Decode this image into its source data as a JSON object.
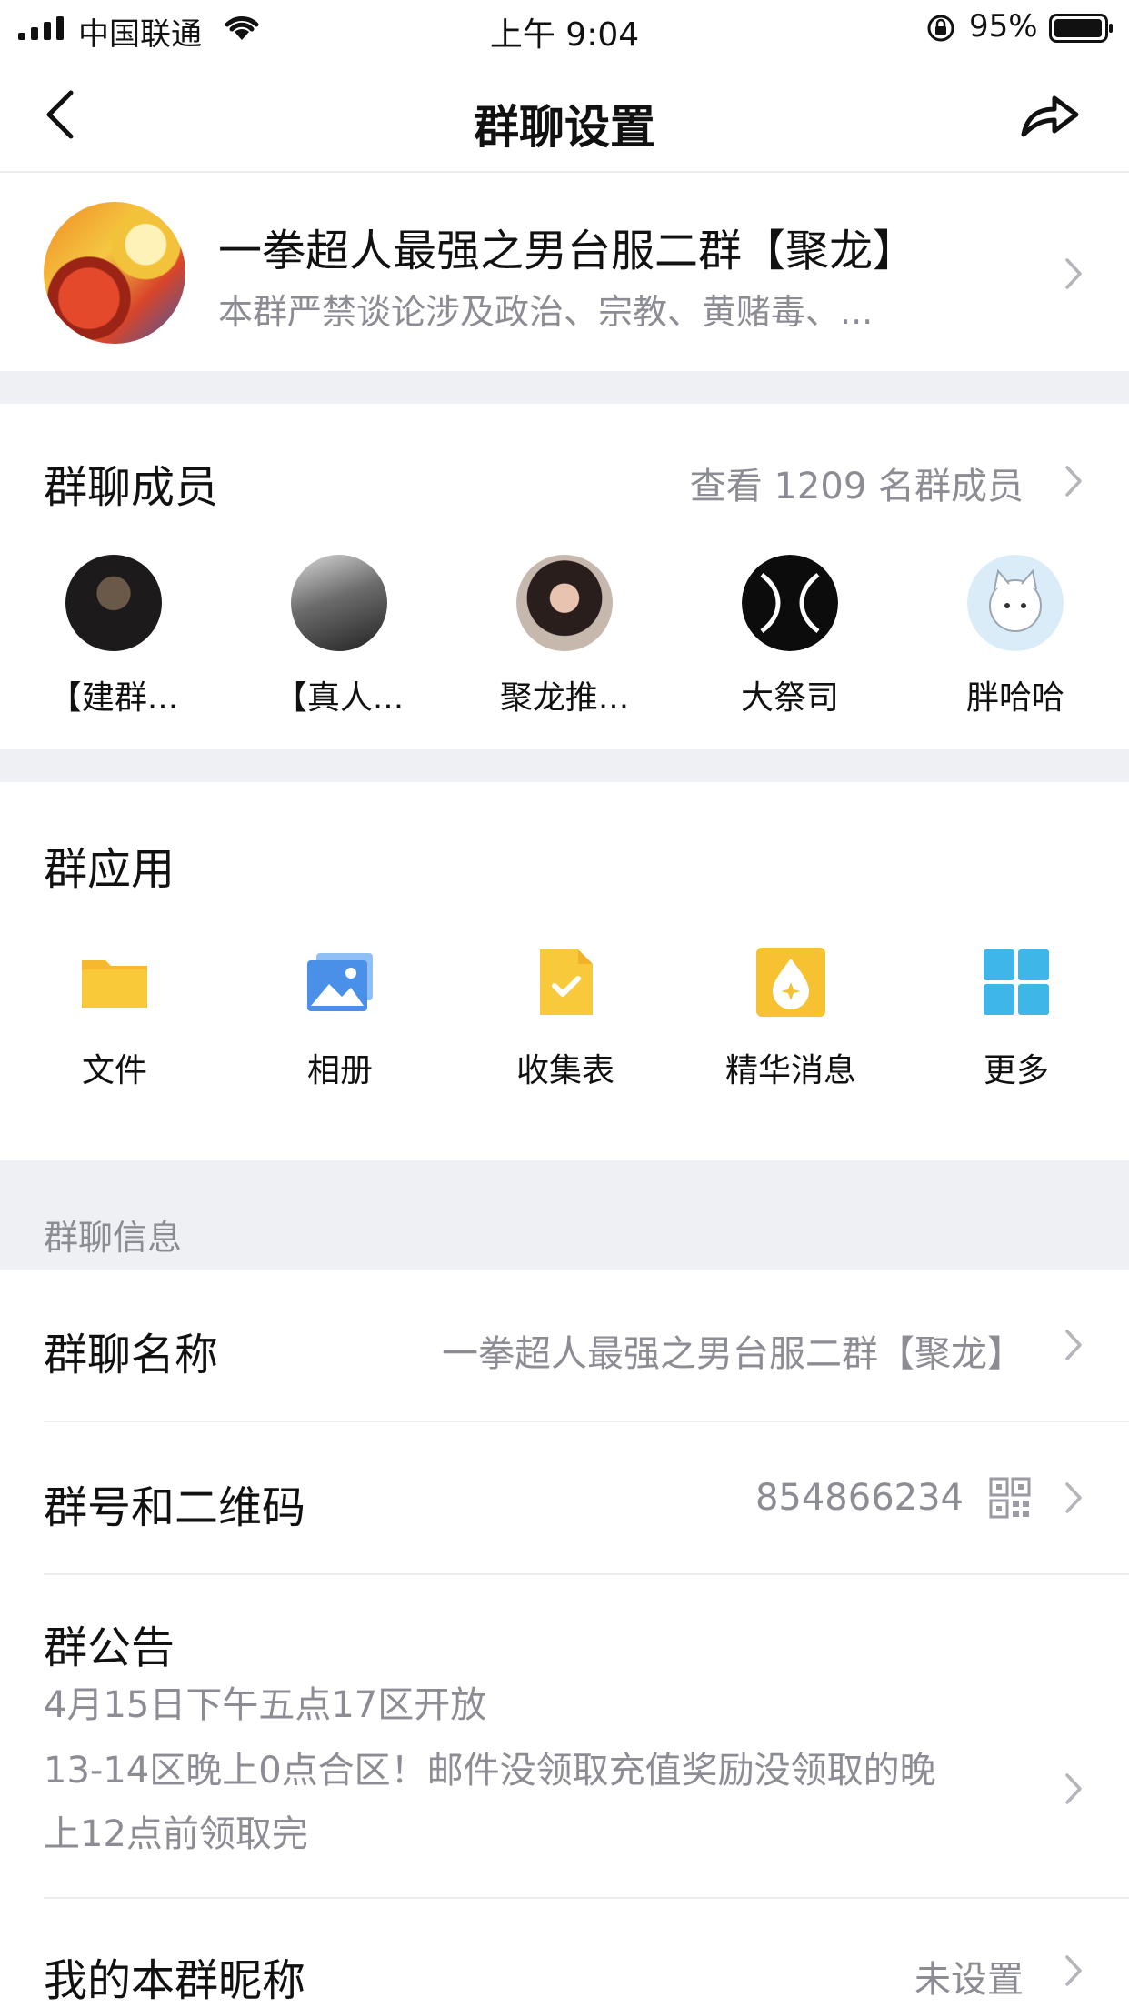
{
  "status_bar": {
    "carrier": "中国联通",
    "time": "上午 9:04",
    "battery": "95%"
  },
  "nav": {
    "title": "群聊设置"
  },
  "group": {
    "name": "一拳超人最强之男台服二群【聚龙】",
    "description": "本群严禁谈论涉及政治、宗教、黄赌毒、..."
  },
  "members": {
    "title": "群聊成员",
    "view_all": "查看 1209 名群成员",
    "items": [
      {
        "name": "【建群..."
      },
      {
        "name": "【真人..."
      },
      {
        "name": "聚龙推..."
      },
      {
        "name": "大祭司"
      },
      {
        "name": "胖哈哈"
      }
    ]
  },
  "apps": {
    "title": "群应用",
    "items": [
      {
        "label": "文件",
        "icon": "folder-icon"
      },
      {
        "label": "相册",
        "icon": "album-icon"
      },
      {
        "label": "收集表",
        "icon": "form-icon"
      },
      {
        "label": "精华消息",
        "icon": "essence-icon"
      },
      {
        "label": "更多",
        "icon": "grid-icon"
      }
    ]
  },
  "info": {
    "section_label": "群聊信息",
    "group_name_label": "群聊名称",
    "group_name_value": "一拳超人最强之男台服二群【聚龙】",
    "group_number_label": "群号和二维码",
    "group_number_value": "854866234",
    "notice_label": "群公告",
    "notice_lines": [
      "4月15日下午五点17区开放",
      "13-14区晚上0点合区！邮件没领取充值奖励没领取的晚",
      "上12点前领取完"
    ],
    "nickname_label": "我的本群昵称",
    "nickname_value": "未设置"
  },
  "colors": {
    "gap": "#eff0f4",
    "secondary_text": "#8c8c94",
    "folder": "#f9c93a",
    "album": "#4a90e8",
    "grid": "#3fb6e8"
  }
}
